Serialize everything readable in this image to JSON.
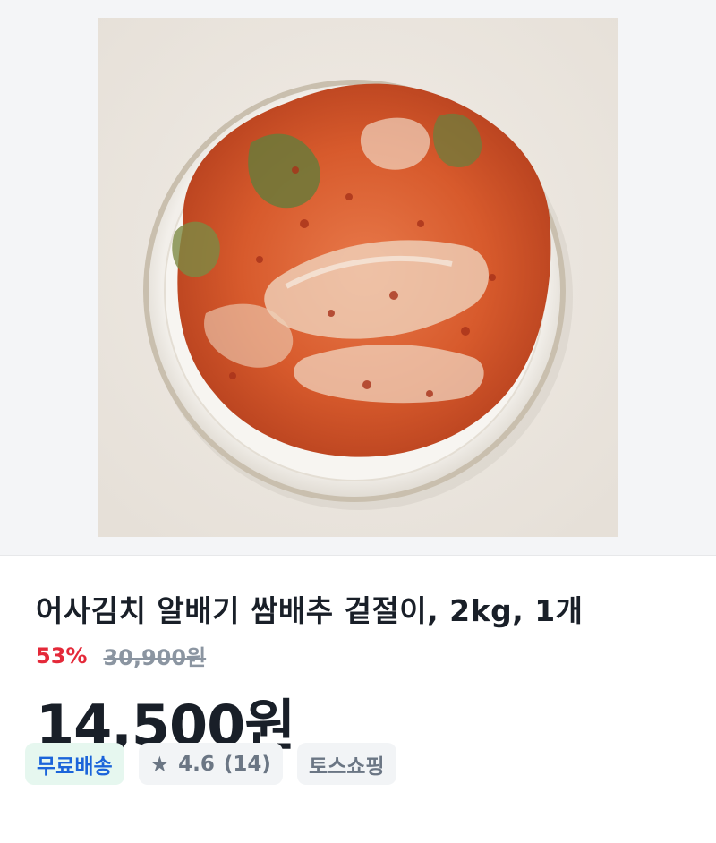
{
  "product": {
    "title": "어사김치 알배기 쌈배추 겉절이, 2kg, 1개",
    "discount_rate": "53%",
    "original_price": "30,900원",
    "sale_price": "14,500원",
    "image_alt": "kimchi-plate-photo"
  },
  "badges": {
    "shipping": "무료배송",
    "rating": "4.6",
    "review_count": "(14)",
    "store": "토스쇼핑",
    "rating_icon": "star-icon"
  },
  "colors": {
    "discount": "#e42939",
    "shipping_text": "#1b64da",
    "shipping_bg": "#e6f7ef",
    "badge_bg": "#f2f4f6"
  }
}
